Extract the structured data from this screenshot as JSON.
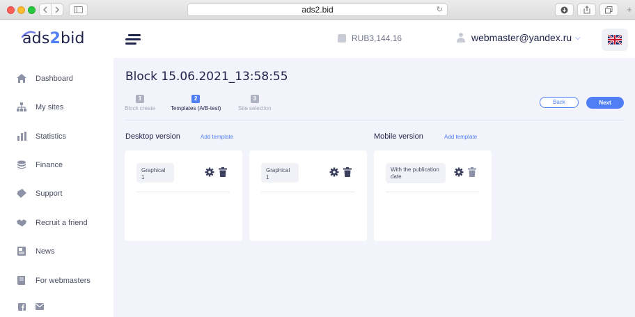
{
  "browser": {
    "url": "ads2.bid",
    "icons": [
      "back-icon",
      "forward-icon",
      "sidebar-icon",
      "reload-icon",
      "download-icon",
      "share-icon",
      "tabs-icon",
      "new-tab-icon"
    ]
  },
  "header": {
    "logo_prefix": "ads",
    "logo_two": "2",
    "logo_suffix": "bid",
    "balance": "RUB3,144.16",
    "user_email": "webmaster@yandex.ru",
    "language_flag": "uk-flag-icon"
  },
  "sidebar": {
    "items": [
      {
        "label": "Dashboard",
        "icon": "home-icon"
      },
      {
        "label": "My sites",
        "icon": "sitemap-icon"
      },
      {
        "label": "Statistics",
        "icon": "bar-chart-icon"
      },
      {
        "label": "Finance",
        "icon": "coins-icon"
      },
      {
        "label": "Support",
        "icon": "ticket-icon"
      },
      {
        "label": "Recruit a friend",
        "icon": "handshake-icon"
      },
      {
        "label": "News",
        "icon": "newspaper-icon"
      },
      {
        "label": "For webmasters",
        "icon": "book-icon"
      }
    ],
    "social": [
      "facebook-icon",
      "mail-icon"
    ]
  },
  "main": {
    "title": "Block 15.06.2021_13:58:55",
    "steps": [
      {
        "num": "1",
        "label": "Block create"
      },
      {
        "num": "2",
        "label": "Templates (A/B-test)"
      },
      {
        "num": "3",
        "label": "Site selection"
      }
    ],
    "back_label": "Back",
    "next_label": "Next",
    "desktop": {
      "title": "Desktop version",
      "add_label": "Add template",
      "templates": [
        "Graphical 1",
        "Graphical 1"
      ]
    },
    "mobile": {
      "title": "Mobile version",
      "add_label": "Add template",
      "templates": [
        "With the publication date"
      ]
    }
  },
  "colors": {
    "accent": "#4f7ef5",
    "dark": "#20234a",
    "main_bg": "#f3f4fb"
  }
}
